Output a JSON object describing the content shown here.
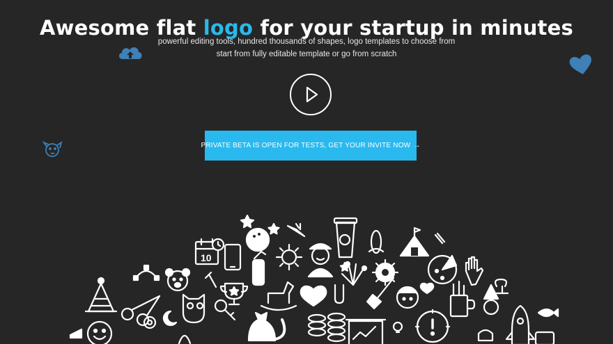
{
  "hero": {
    "title_before": "Awesome flat ",
    "title_accent": "logo",
    "title_after": " for your startup in minutes",
    "subtitle_line1": "powerful editing tools, hundred thousands of shapes, logo templates to choose from",
    "subtitle_line2": "start from fully editable template or go from scratch"
  },
  "video": {
    "icon": "play-icon"
  },
  "cta": {
    "label": "PRIVATE BETA IS OPEN FOR TESTS, GET YOUR INVITE NOW",
    "arrow": "→"
  },
  "decor": {
    "floating_icons": [
      "cloud-upload-icon",
      "heart-icon",
      "dog-icon"
    ],
    "pile_icons": [
      "star-icon",
      "bowling-icon",
      "carrot-icon",
      "coffee-cup-icon",
      "corn-icon",
      "circus-tent-icon",
      "calendar-icon",
      "phone-icon",
      "fire-extinguisher-icon",
      "sun-icon",
      "pilot-icon",
      "fireworks-icon",
      "gear-icon",
      "pizza-icon",
      "glove-icon",
      "party-hat-icon",
      "vector-tool-icon",
      "bear-icon",
      "trophy-icon",
      "rocking-horse-icon",
      "heart-icon",
      "shovel-icon",
      "cup-icon",
      "scissors-icon",
      "owl-icon",
      "key-icon",
      "cat-icon",
      "coins-icon",
      "presentation-icon",
      "warning-icon",
      "rocket-icon",
      "fish-icon",
      "smile-icon"
    ],
    "accent_color": "#2bb8ea",
    "icon_blue": "#3f80b8",
    "background": "#262627"
  }
}
